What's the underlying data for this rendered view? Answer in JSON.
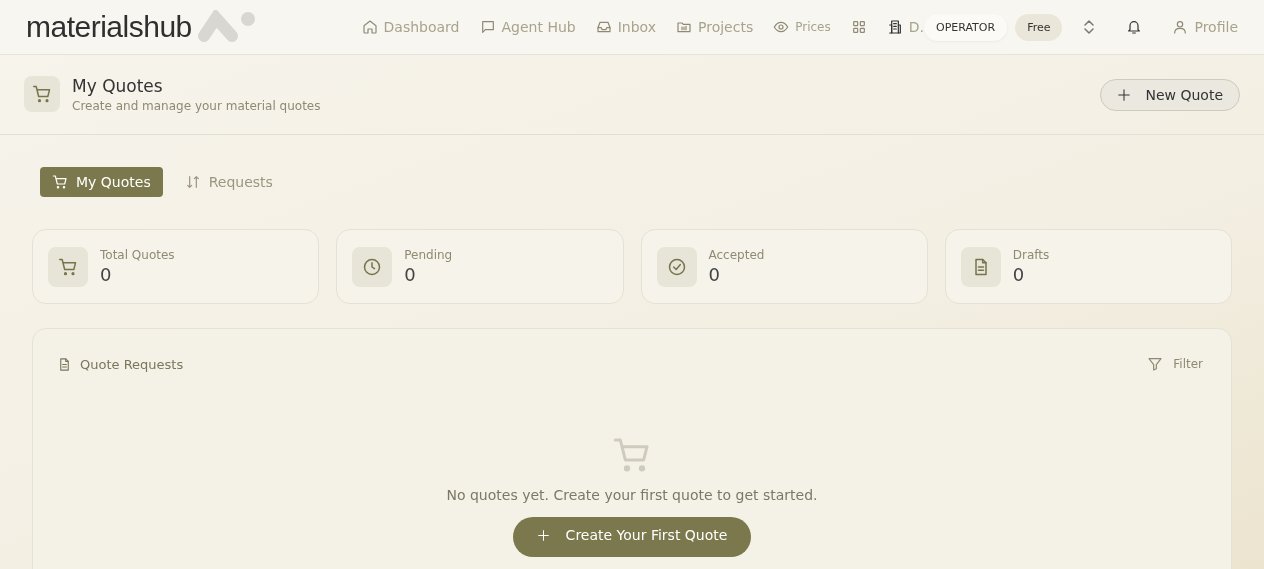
{
  "brand": "materialshub",
  "nav": [
    {
      "kind": "home",
      "label": "Dashboard"
    },
    {
      "kind": "chat",
      "label": "Agent Hub"
    },
    {
      "kind": "inbox",
      "label": "Inbox"
    },
    {
      "kind": "folder",
      "label": "Projects"
    },
    {
      "kind": "eye",
      "label": "Prices"
    },
    {
      "kind": "grid"
    },
    {
      "kind": "building",
      "label": "D."
    }
  ],
  "role_badge": "OPERATOR",
  "plan_badge": "Free",
  "profile": "Profile",
  "page": {
    "title": "My Quotes",
    "subtitle": "Create and manage your material quotes",
    "new_button": "New Quote"
  },
  "tabs": [
    {
      "kind": "cart",
      "label": "My Quotes",
      "selected": true
    },
    {
      "kind": "sort",
      "label": "Requests",
      "selected": false
    }
  ],
  "stats": [
    {
      "kind": "cart",
      "label": "Total Quotes",
      "value": "0"
    },
    {
      "kind": "clock",
      "label": "Pending",
      "value": "0"
    },
    {
      "kind": "check",
      "label": "Accepted",
      "value": "0"
    },
    {
      "kind": "doc",
      "label": "Drafts",
      "value": "0"
    }
  ],
  "panel": {
    "title": "Quote Requests",
    "filter": "Filter",
    "empty_text": "No quotes yet. Create your first quote to get started.",
    "create_button": "Create Your First Quote"
  }
}
